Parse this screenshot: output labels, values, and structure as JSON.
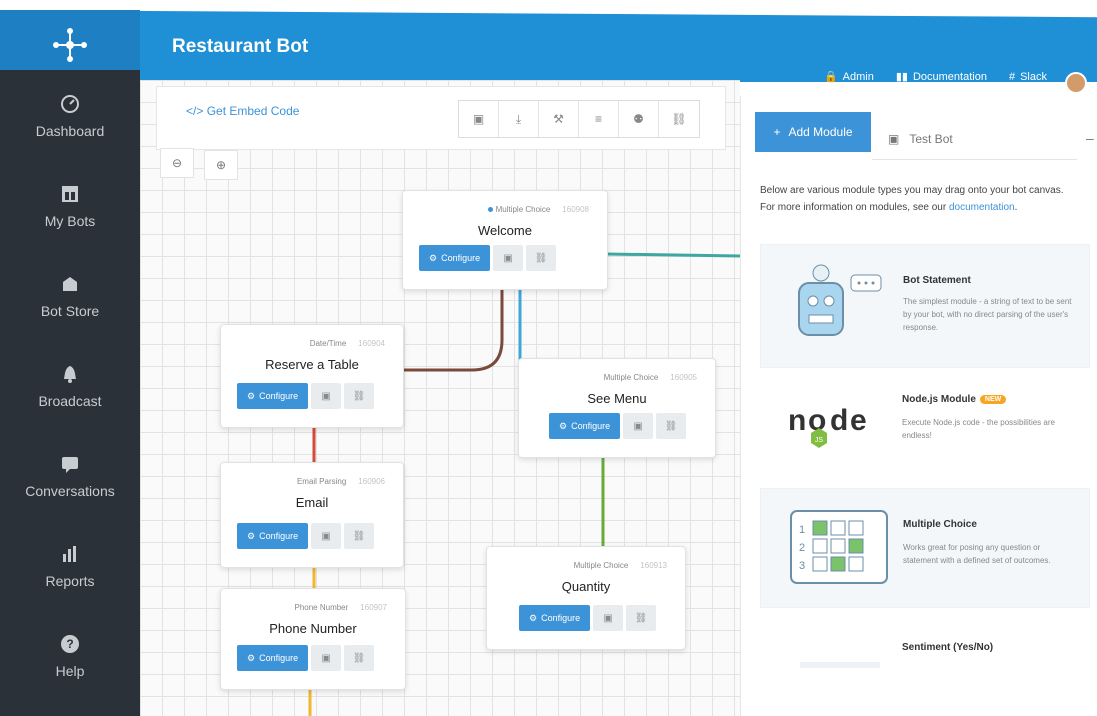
{
  "app": {
    "title": "Restaurant Bot"
  },
  "topbar": {
    "links": [
      {
        "label": "Admin",
        "icon": "lock-icon"
      },
      {
        "label": "Documentation",
        "icon": "book-icon"
      },
      {
        "label": "Slack",
        "icon": "slack-icon"
      }
    ]
  },
  "sidebar": {
    "items": [
      {
        "label": "Dashboard",
        "icon": "dashboard-icon"
      },
      {
        "label": "My Bots",
        "icon": "bots-icon"
      },
      {
        "label": "Bot Store",
        "icon": "store-icon"
      },
      {
        "label": "Broadcast",
        "icon": "bell-icon"
      },
      {
        "label": "Conversations",
        "icon": "chat-icon"
      },
      {
        "label": "Reports",
        "icon": "bar-chart-icon"
      },
      {
        "label": "Help",
        "icon": "help-icon"
      }
    ]
  },
  "canvas": {
    "embed_label": "Get Embed Code",
    "embed_icon": "</>",
    "toolbar": [
      "chat-icon",
      "download-icon",
      "wrench-icon",
      "list-icon",
      "users-icon",
      "link-icon"
    ],
    "zoom": [
      "zoom-out-icon",
      "zoom-in-icon"
    ],
    "configure_label": "Configure",
    "nodes": [
      {
        "type": "Multiple Choice",
        "id": "160908",
        "title": "Welcome"
      },
      {
        "type": "Date/Time",
        "id": "160904",
        "title": "Reserve a Table"
      },
      {
        "type": "Multiple Choice",
        "id": "160905",
        "title": "See Menu"
      },
      {
        "type": "Email Parsing",
        "id": "160906",
        "title": "Email"
      },
      {
        "type": "Multiple Choice",
        "id": "160913",
        "title": "Quantity"
      },
      {
        "type": "Phone Number",
        "id": "160907",
        "title": "Phone Number"
      }
    ]
  },
  "panel": {
    "add_module_label": "Add Module",
    "add_module_icon": "+",
    "test_bot_label": "Test Bot",
    "collapse_label": "–",
    "description": "Below are various module types you may drag onto your bot canvas.",
    "description_more": "For more information on modules, see our",
    "doc_link": "documentation",
    "modules": [
      {
        "title": "Bot Statement",
        "desc": "The simplest module - a string of text to be sent by your bot, with no direct parsing of the user's response."
      },
      {
        "title": "Node.js Module",
        "badge": "NEW",
        "desc": "Execute Node.js code - the possibilities are endless!",
        "logo_text": "node",
        "logo_sub": "JS"
      },
      {
        "title": "Multiple Choice",
        "desc": "Works great for posing any question or statement with a defined set of outcomes."
      },
      {
        "title": "Sentiment (Yes/No)",
        "desc": ""
      }
    ]
  },
  "colors": {
    "brand_blue": "#1f8fd6",
    "sidebar_bg": "#2b3138",
    "accent": "#3d93d8",
    "line_brown": "#7a4a3b",
    "line_teal": "#3fa7a0",
    "line_blue": "#3fa7d8",
    "line_red": "#d24a3a",
    "line_green": "#6aaa3a",
    "line_orange": "#f2b630"
  }
}
